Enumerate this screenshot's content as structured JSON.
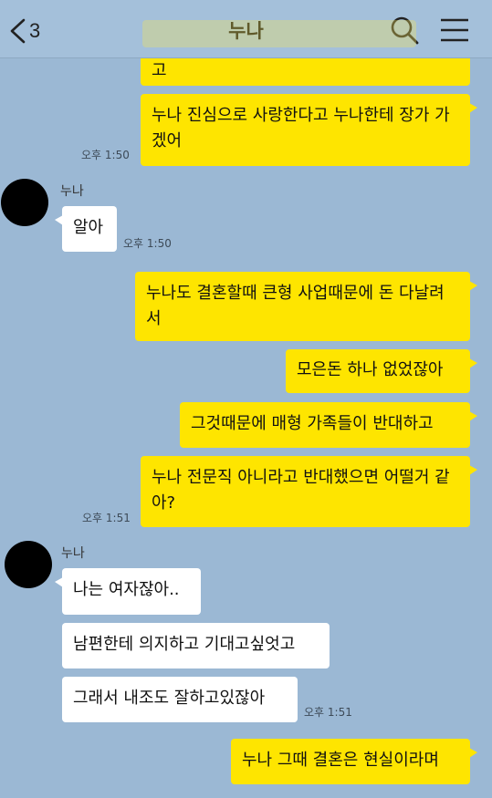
{
  "header": {
    "back_count": "3",
    "title": "누나",
    "back_icon": "chevron-left-icon",
    "search_icon": "search-icon",
    "menu_icon": "hamburger-menu-icon"
  },
  "colors": {
    "chat_background": "#9bb8d4",
    "my_bubble": "#fee500",
    "other_bubble": "#ffffff"
  },
  "messages": [
    {
      "sender": "me",
      "text": "고"
    },
    {
      "sender": "me",
      "text": "누나 진심으로 사랑한다고 누나한테 장가 가겠어",
      "time": "오후 1:50"
    },
    {
      "sender": "other",
      "name": "누나",
      "text": "알아",
      "time": "오후 1:50"
    },
    {
      "sender": "me",
      "text": "누나도 결혼할때 큰형 사업때문에 돈 다날려서"
    },
    {
      "sender": "me",
      "text": "모은돈 하나 없었잖아"
    },
    {
      "sender": "me",
      "text": "그것때문에 매형 가족들이 반대하고"
    },
    {
      "sender": "me",
      "text": "누나 전문직 아니라고 반대했으면 어떨거 같아?",
      "time": "오후 1:51"
    },
    {
      "sender": "other",
      "name": "누나",
      "text": "나는 여자잖아.."
    },
    {
      "sender": "other",
      "text": "남편한테 의지하고 기대고싶엇고"
    },
    {
      "sender": "other",
      "text": "그래서 내조도 잘하고있잖아",
      "time": "오후 1:51"
    },
    {
      "sender": "me",
      "text": "누나 그때 결혼은 현실이라며"
    }
  ]
}
